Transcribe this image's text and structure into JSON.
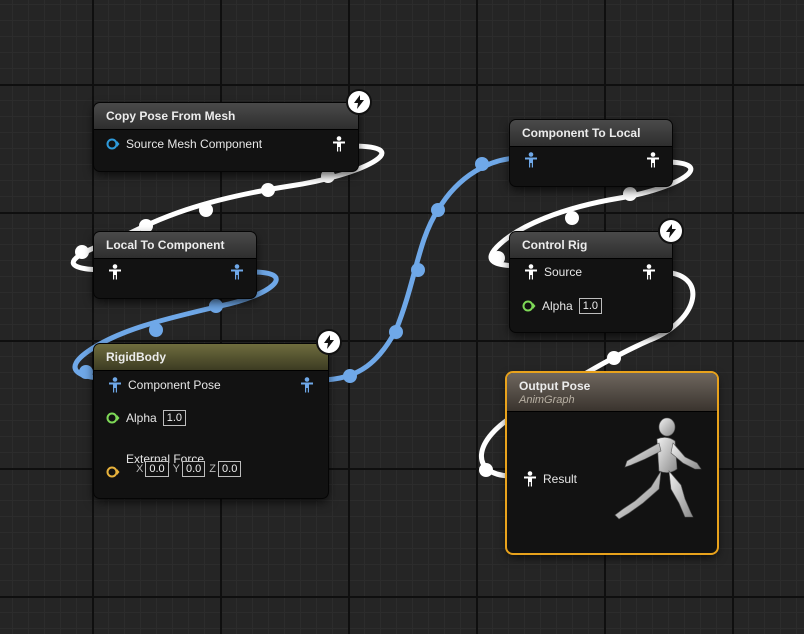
{
  "nodes": {
    "copy_pose": {
      "title": "Copy Pose From Mesh",
      "source_label": "Source Mesh Component"
    },
    "local_to_component": {
      "title": "Local To Component"
    },
    "rigidbody": {
      "title": "RigidBody",
      "component_pose_label": "Component Pose",
      "alpha_label": "Alpha",
      "alpha_value": "1.0",
      "external_force_label": "External Force",
      "x_label": "X",
      "x_value": "0.0",
      "y_label": "Y",
      "y_value": "0.0",
      "z_label": "Z",
      "z_value": "0.0"
    },
    "component_to_local": {
      "title": "Component To Local"
    },
    "control_rig": {
      "title": "Control Rig",
      "source_label": "Source",
      "alpha_label": "Alpha",
      "alpha_value": "1.0"
    },
    "output_pose": {
      "title": "Output Pose",
      "subtitle": "AnimGraph",
      "result_label": "Result"
    }
  },
  "colors": {
    "white_wire": "#ffffff",
    "blue_wire": "#6fa8e8",
    "float_pin": "#7ed957",
    "vector_pin": "#e8b23c",
    "object_pin": "#2e9bdc",
    "output_border": "#e8a21c"
  },
  "icons": {
    "pose_pin": "pose-figure-icon",
    "fast_path": "lightning-bolt-icon"
  }
}
